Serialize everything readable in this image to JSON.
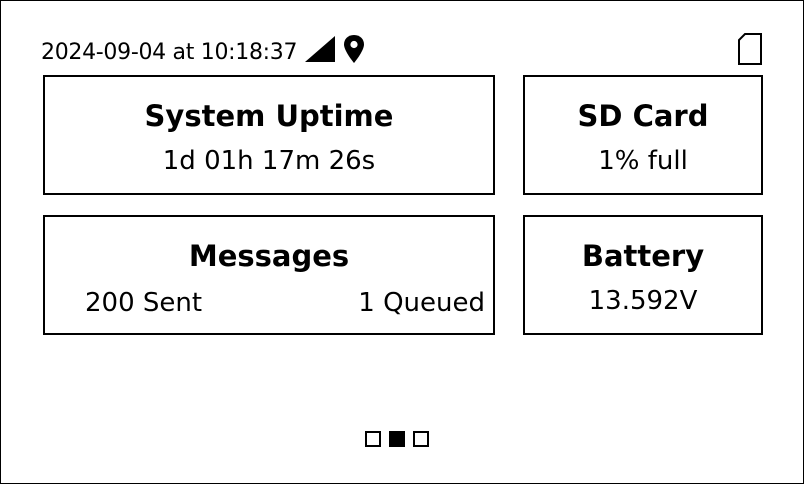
{
  "status_bar": {
    "datetime": "2024-09-04 at 10:18:37",
    "icons": [
      "signal-icon",
      "location-pin-icon",
      "sd-card-icon"
    ]
  },
  "cards": {
    "uptime": {
      "title": "System Uptime",
      "value": "1d 01h 17m 26s"
    },
    "sd_card": {
      "title": "SD Card",
      "value": "1% full"
    },
    "messages": {
      "title": "Messages",
      "sent": "200 Sent",
      "queued": "1 Queued"
    },
    "battery": {
      "title": "Battery",
      "value": "13.592V"
    }
  },
  "pager": {
    "page_count": 3,
    "active_page": 2
  },
  "colors": {
    "foreground": "#000000",
    "background": "#ffffff"
  }
}
